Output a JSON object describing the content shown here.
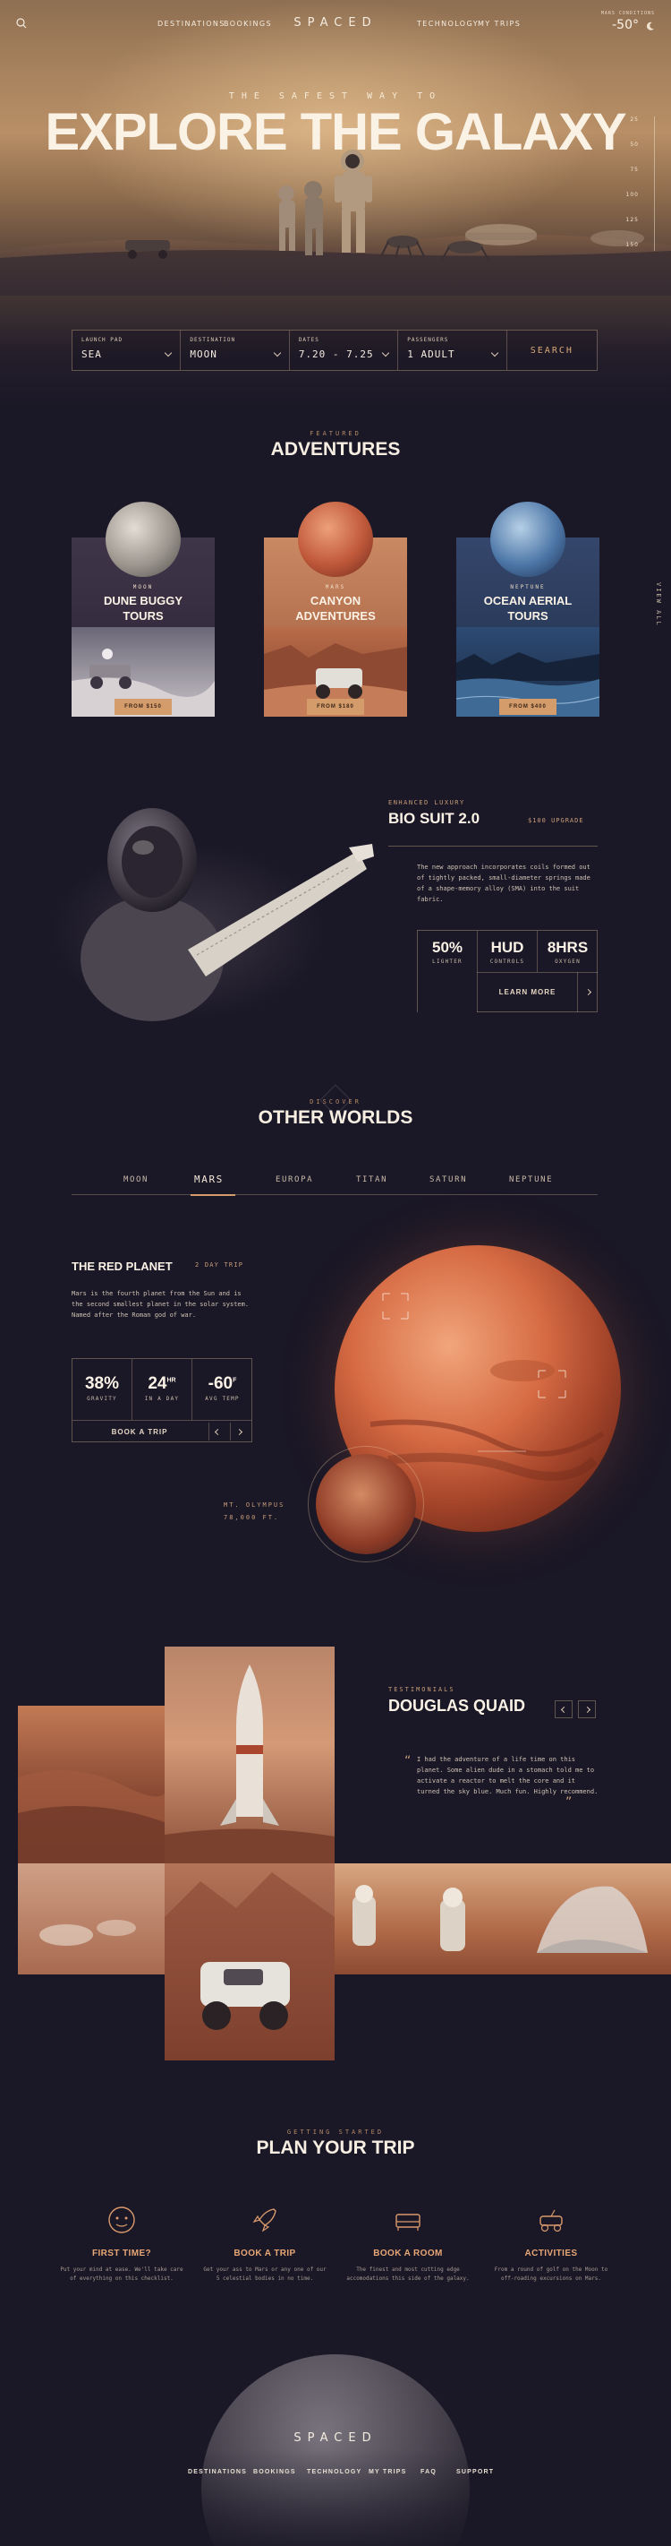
{
  "header": {
    "logo": "SPACED",
    "nav": [
      "DESTINATIONS",
      "BOOKINGS",
      "TECHNOLOGY",
      "MY TRIPS"
    ],
    "weather_label": "MARS CONDITIONS",
    "weather_temp": "-50°",
    "weather_icon": "moon-icon"
  },
  "hero": {
    "subtitle": "THE SAFEST WAY TO",
    "title": "EXPLORE THE GALAXY",
    "scale_labels": [
      "25",
      "50",
      "75",
      "100",
      "125",
      "150"
    ]
  },
  "booking": {
    "fields": [
      {
        "label": "LAUNCH PAD",
        "value": "SEA"
      },
      {
        "label": "DESTINATION",
        "value": "MOON"
      },
      {
        "label": "DATES",
        "value": "7.20 - 7.25"
      },
      {
        "label": "PASSENGERS",
        "value": "1 ADULT"
      }
    ],
    "search_label": "SEARCH"
  },
  "featured": {
    "eyebrow": "FEATURED",
    "title": "ADVENTURES",
    "side_label": "VIEW ALL",
    "cards": [
      {
        "eyebrow": "MOON",
        "title_line1": "DUNE BUGGY",
        "title_line2": "TOURS",
        "button": "FROM $150",
        "bg": "#3e3448",
        "planet": "moon"
      },
      {
        "eyebrow": "MARS",
        "title_line1": "CANYON",
        "title_line2": "ADVENTURES",
        "button": "FROM $180",
        "bg": "#b9704a",
        "planet": "mars"
      },
      {
        "eyebrow": "NEPTUNE",
        "title_line1": "OCEAN AERIAL",
        "title_line2": "TOURS",
        "button": "FROM $400",
        "bg": "#2e3d5e",
        "planet": "neptune"
      }
    ]
  },
  "biosuit": {
    "eyebrow": "ENHANCED LUXURY",
    "title": "BIO SUIT 2.0",
    "upgrade": "$100 UPGRADE",
    "description": "The new approach incorporates coils formed out of tightly packed, small-diameter springs made of a shape-memory alloy (SMA) into the suit fabric.",
    "stats": [
      {
        "value": "50%",
        "label": "LIGHTER"
      },
      {
        "value": "HUD",
        "label": "CONTROLS"
      },
      {
        "value": "8HRS",
        "label": "OXYGEN"
      }
    ],
    "learn_more": "LEARN MORE"
  },
  "worlds": {
    "eyebrow": "DISCOVER",
    "title": "OTHER WORLDS",
    "tabs": [
      "MOON",
      "MARS",
      "EUROPA",
      "TITAN",
      "SATURN",
      "NEPTUNE"
    ],
    "active_tab": "MARS",
    "planet_title": "THE RED PLANET",
    "trip": "2 DAY TRIP",
    "description": "Mars is the fourth planet from the Sun and is the second smallest planet in the solar system. Named after the Roman god of war.",
    "stats": [
      {
        "value": "38%",
        "unit": "",
        "label": "GRAVITY"
      },
      {
        "value": "24",
        "unit": "HR",
        "label": "IN A DAY"
      },
      {
        "value": "-60",
        "unit": "F",
        "label": "AVG TEMP"
      }
    ],
    "book_trip": "BOOK A TRIP",
    "landmark_line1": "MT. OLYMPUS",
    "landmark_line2": "78,000 FT."
  },
  "testimonials": {
    "eyebrow": "TESTIMONIALS",
    "name": "DOUGLAS QUAID",
    "quote": "I had the adventure of a life time on this planet. Some alien dude in a stomach told me to activate a reactor to melt the core and it turned the sky blue. Much fun. Highly recommend."
  },
  "plan": {
    "eyebrow": "GETTING STARTED",
    "title": "PLAN YOUR TRIP",
    "steps": [
      {
        "title": "FIRST TIME?",
        "desc": "Put your mind at ease. We'll take care of everything on this checklist.",
        "icon": "face-icon"
      },
      {
        "title": "BOOK A TRIP",
        "desc": "Get your ass to Mars or any one of our 5 celestial bodies in no time.",
        "icon": "rocket-icon"
      },
      {
        "title": "BOOK A ROOM",
        "desc": "The finest and most cutting edge accomodations this side of the galaxy.",
        "icon": "bed-icon"
      },
      {
        "title": "ACTIVITIES",
        "desc": "From a round of golf on the Moon to off-roading excursions on Mars.",
        "icon": "rover-icon"
      }
    ]
  },
  "footer": {
    "logo": "SPACED",
    "links": [
      "DESTINATIONS",
      "BOOKINGS",
      "TECHNOLOGY",
      "MY TRIPS",
      "FAQ",
      "SUPPORT"
    ]
  }
}
